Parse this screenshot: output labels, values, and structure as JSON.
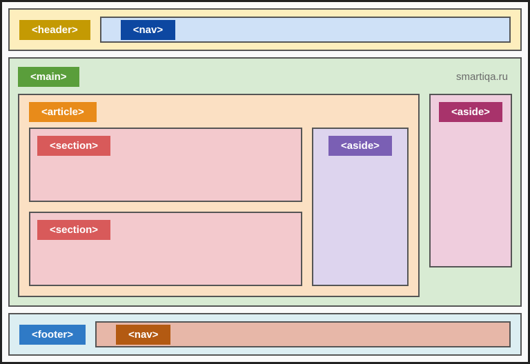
{
  "header": {
    "label": "<header>"
  },
  "nav_top": {
    "label": "<nav>"
  },
  "main": {
    "label": "<main>",
    "watermark": "smartiqa.ru"
  },
  "article": {
    "label": "<article>"
  },
  "sections": [
    {
      "label": "<section>"
    },
    {
      "label": "<section>"
    }
  ],
  "aside_inner": {
    "label": "<aside>"
  },
  "aside_outer": {
    "label": "<aside>"
  },
  "footer": {
    "label": "<footer>"
  },
  "nav_bottom": {
    "label": "<nav>"
  }
}
